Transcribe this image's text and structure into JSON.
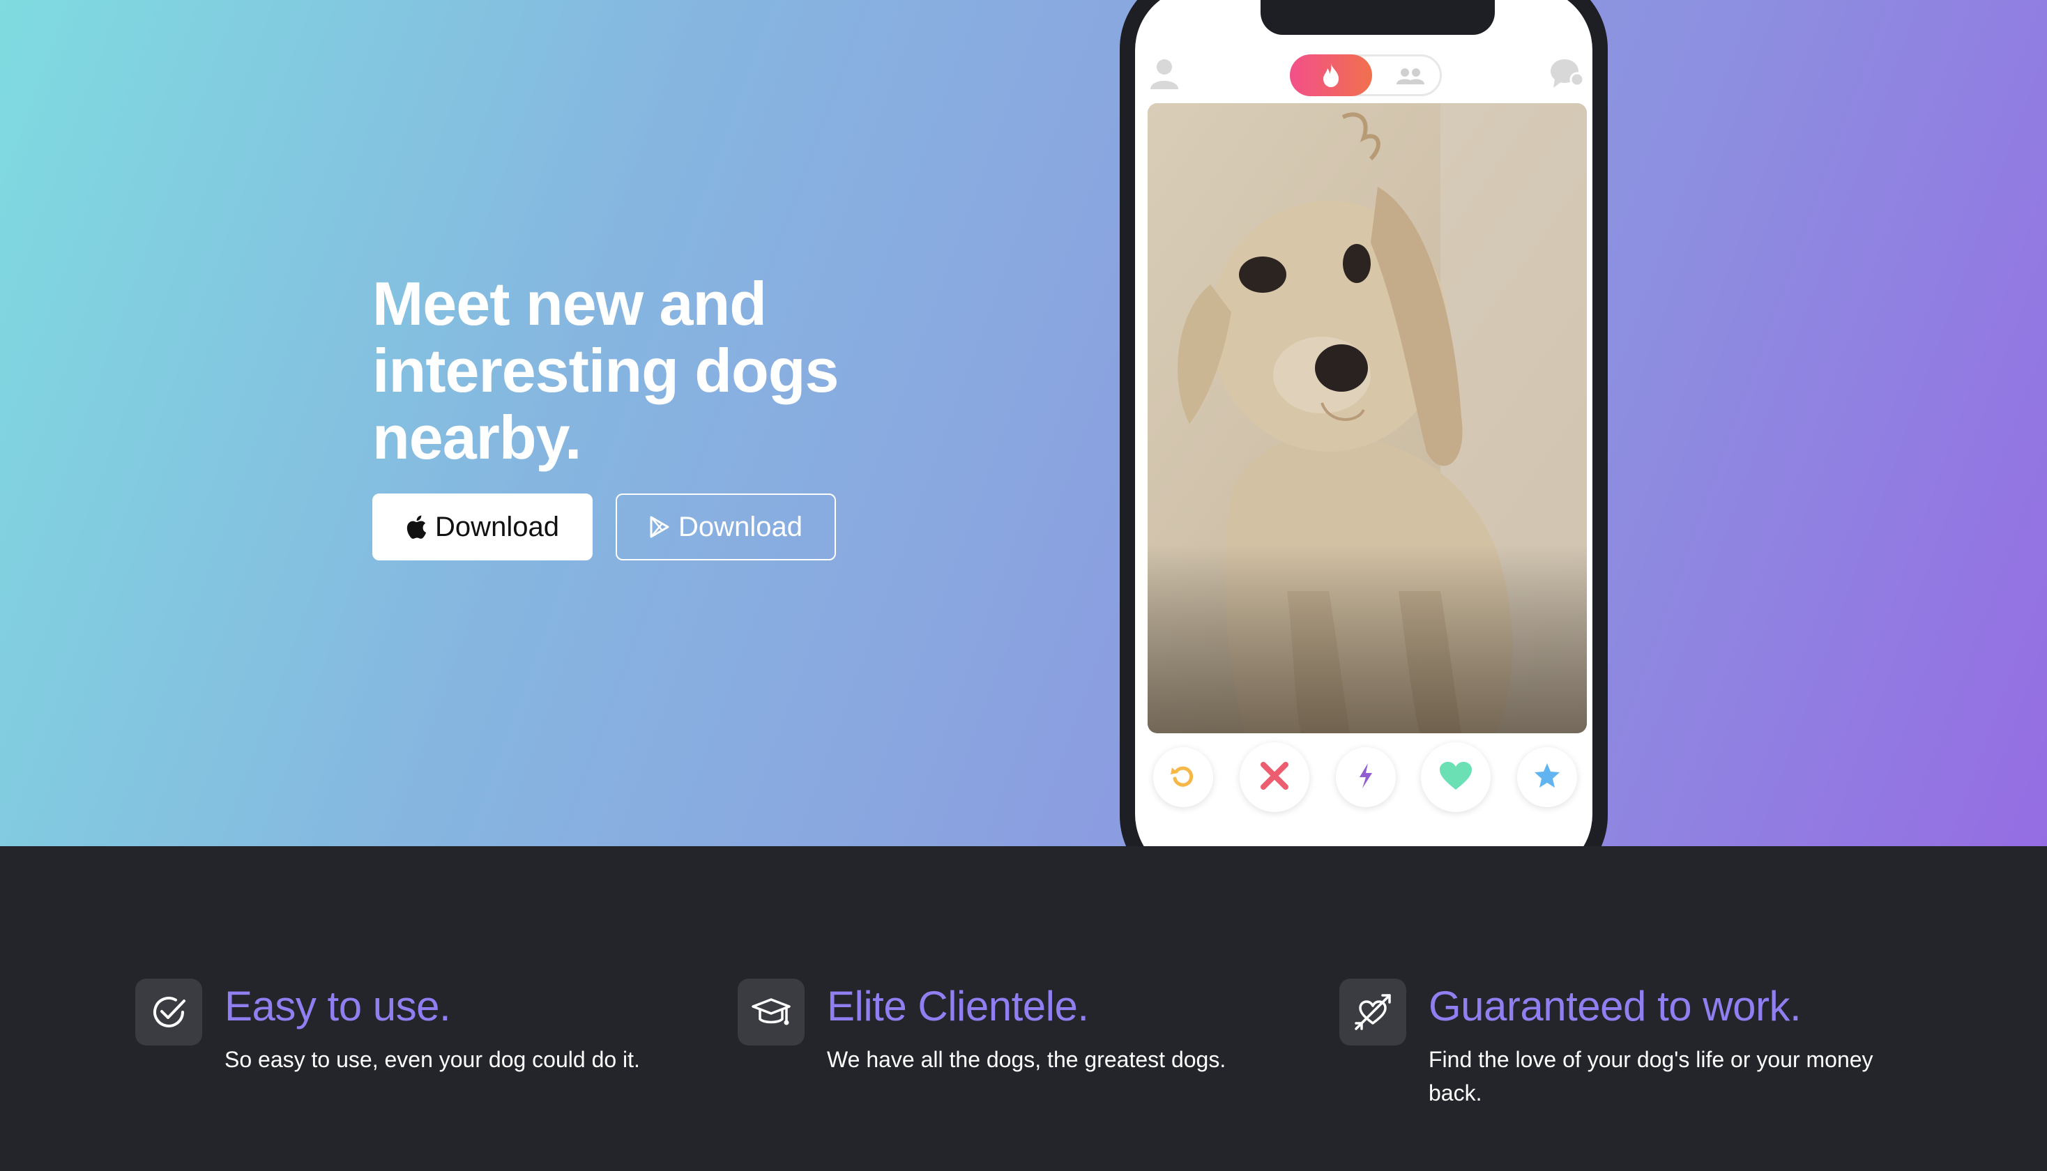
{
  "hero": {
    "title": "Meet new and interesting dogs nearby.",
    "buttons": [
      {
        "label": "Download",
        "icon": "apple-icon"
      },
      {
        "label": "Download",
        "icon": "play-store-icon"
      }
    ],
    "gradient": [
      "#7fdbe0",
      "#956de3"
    ]
  },
  "phone": {
    "top_bar": {
      "left_icon": "profile-icon",
      "toggle_active_icon": "flame-icon",
      "toggle_inactive_icon": "group-icon",
      "right_icon": "chat-icon"
    },
    "card": {
      "subject": "dog-photo"
    },
    "actions": [
      {
        "icon": "rewind-icon",
        "color": "#f5b748"
      },
      {
        "icon": "nope-icon",
        "color": "#ec5e6f"
      },
      {
        "icon": "boost-icon",
        "color": "#915dd1"
      },
      {
        "icon": "like-icon",
        "color": "#6be0b4"
      },
      {
        "icon": "super-like-icon",
        "color": "#62b4f0"
      }
    ]
  },
  "features": [
    {
      "icon": "check-circle-icon",
      "title": "Easy to use.",
      "text": "So easy to use, even your dog could do it."
    },
    {
      "icon": "graduation-cap-icon",
      "title": "Elite Clientele.",
      "text": "We have all the dogs, the greatest dogs."
    },
    {
      "icon": "heart-arrow-icon",
      "title": "Guaranteed to work.",
      "text": "Find the love of your dog's life or your money back."
    }
  ],
  "colors": {
    "accent": "#8f7ff0",
    "dark_bg": "#23252b"
  }
}
